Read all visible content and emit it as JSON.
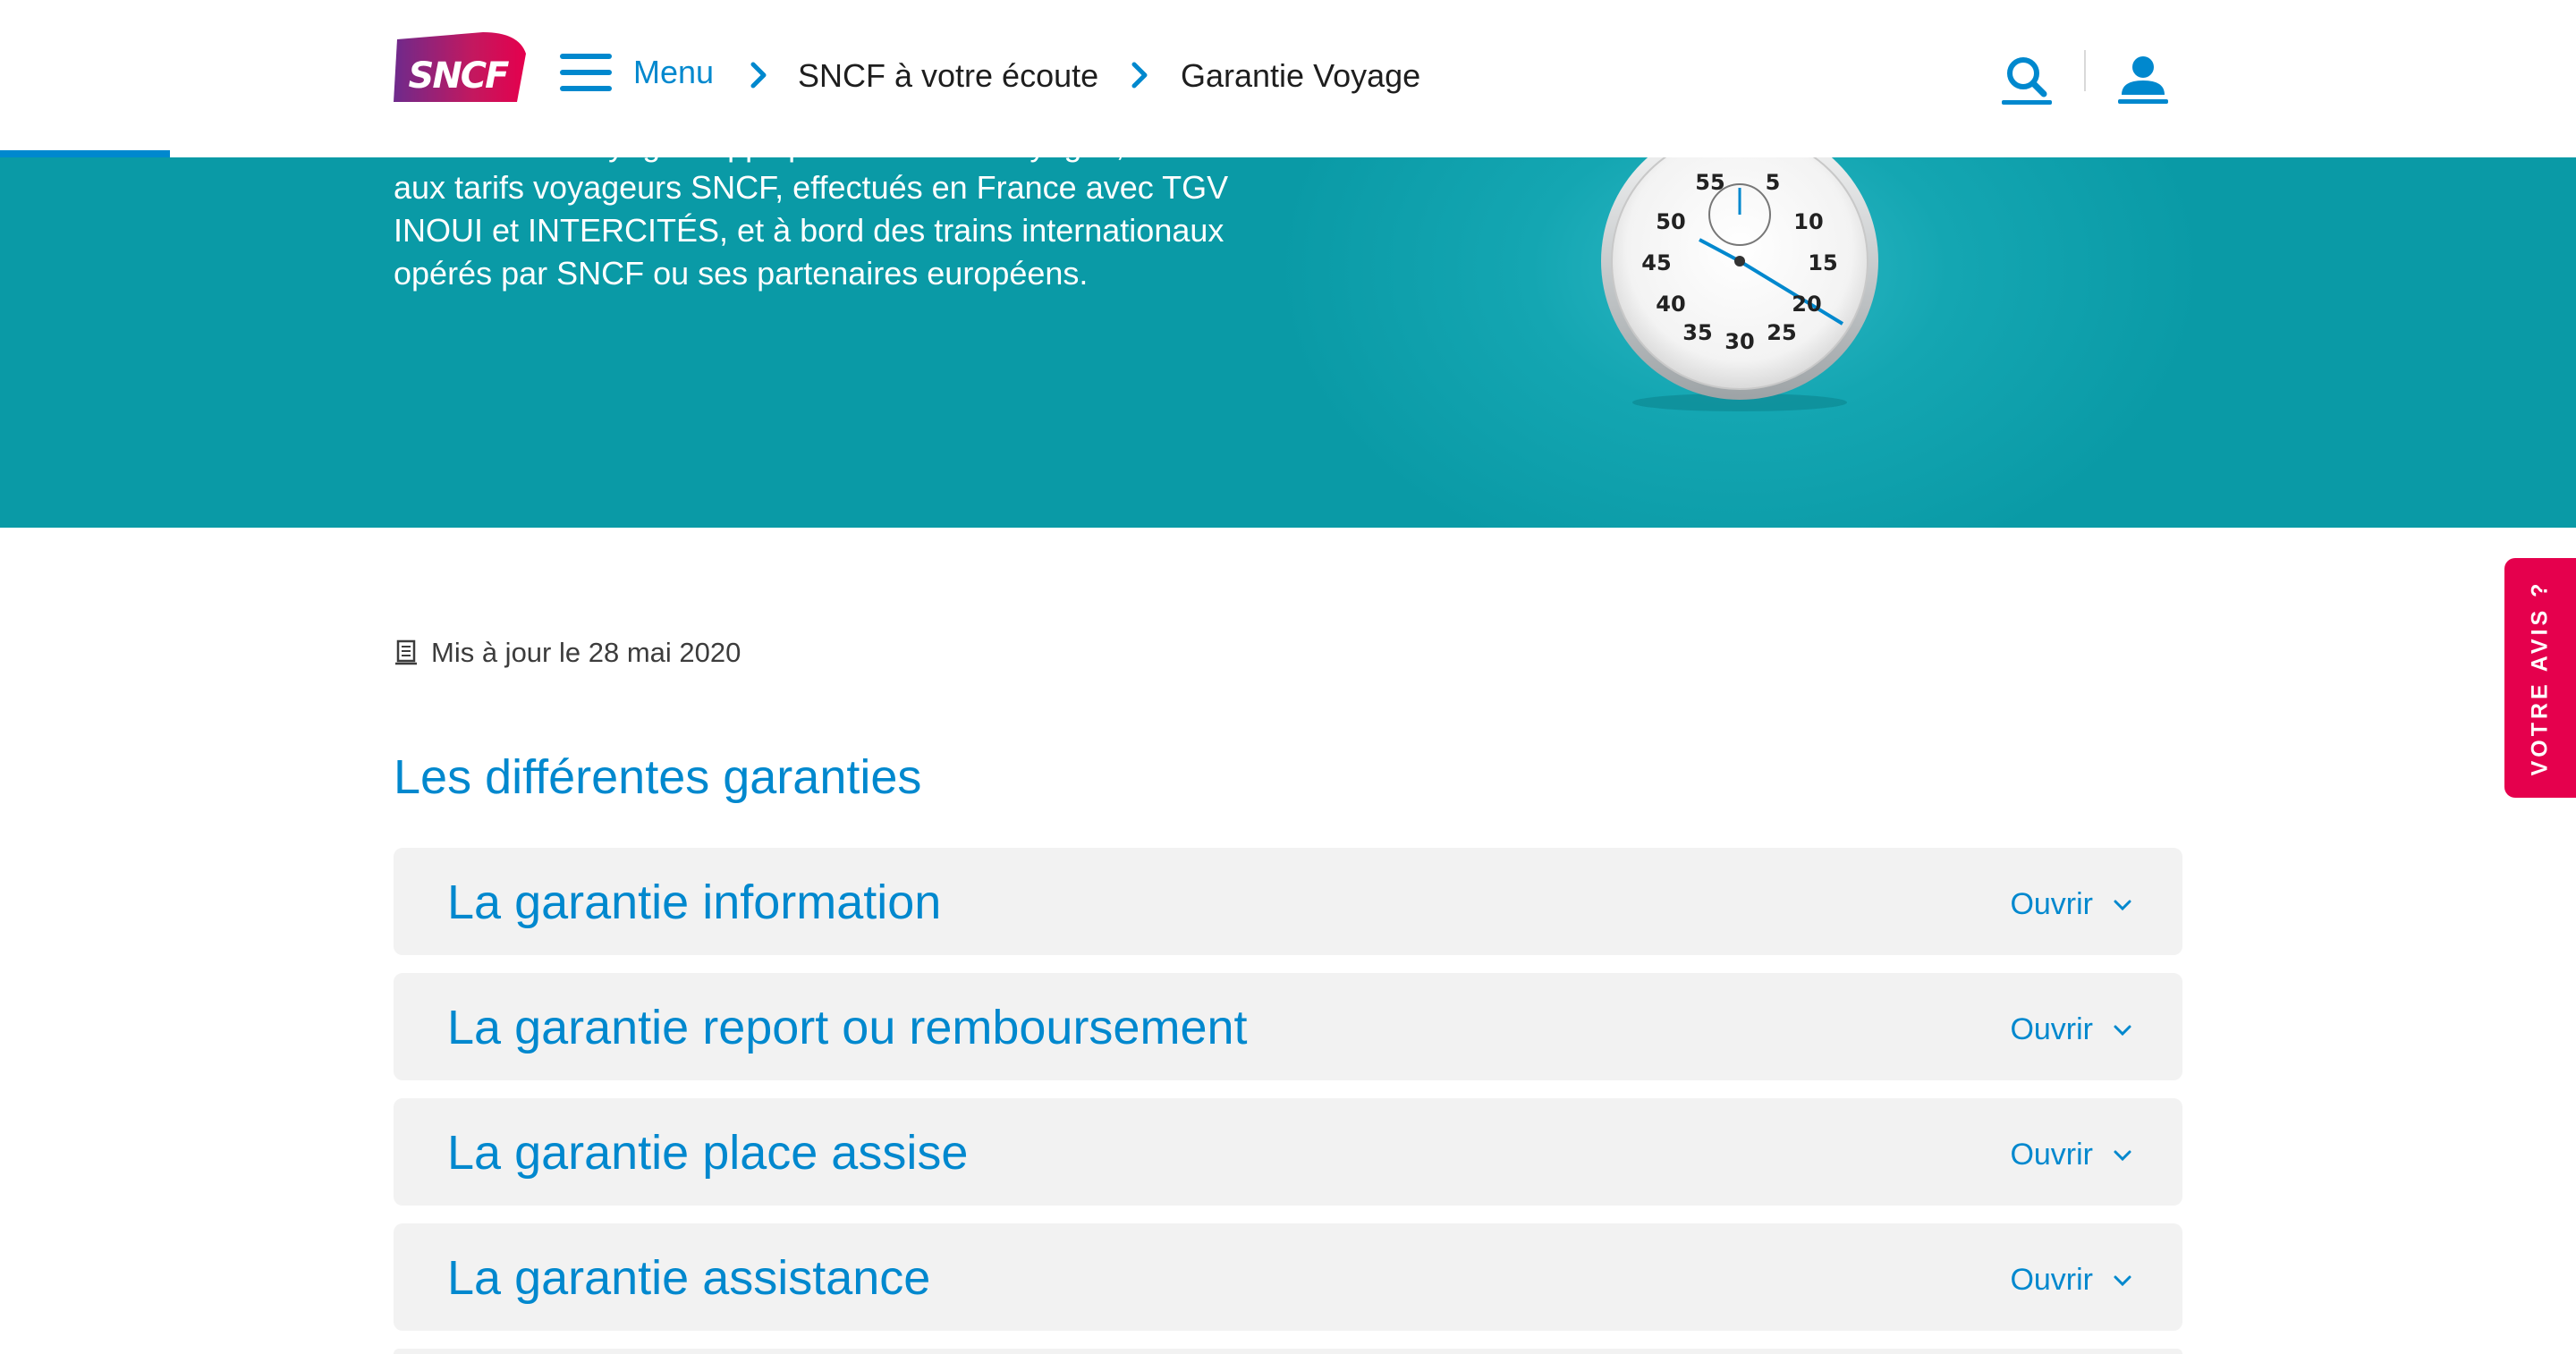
{
  "header": {
    "menu_label": "Menu",
    "breadcrumb": [
      "SNCF à votre écoute",
      "Garantie Voyage"
    ],
    "logo_text": "SNCF",
    "icons": [
      "hamburger-icon",
      "chevron-right-icon",
      "search-icon",
      "user-icon"
    ]
  },
  "hero": {
    "text_lines": [
      "La Garantie Voyage s'applique à tous vos voyages, soumis",
      "aux tarifs voyageurs SNCF, effectués en France avec TGV",
      "INOUI et INTERCITÉS, et à bord des trains internationaux",
      "opérés par SNCF ou ses partenaires européens."
    ],
    "stopwatch_numbers": [
      "55",
      "5",
      "50",
      "10",
      "45",
      "15",
      "40",
      "20",
      "35",
      "30",
      "25"
    ]
  },
  "content": {
    "updated": "Mis à jour le 28 mai 2020",
    "section_title": "Les différentes garanties",
    "accordions": [
      {
        "title": "La garantie information",
        "action": "Ouvrir"
      },
      {
        "title": "La garantie report ou remboursement",
        "action": "Ouvrir"
      },
      {
        "title": "La garantie place assise",
        "action": "Ouvrir"
      },
      {
        "title": "La garantie assistance",
        "action": "Ouvrir"
      }
    ]
  },
  "feedback_tab": "VOTRE AVIS ?",
  "colors": {
    "brand_blue": "#0088ce",
    "hero_teal": "#0a9aa6",
    "feedback_red": "#e5004d",
    "accordion_bg": "#f2f2f2"
  }
}
